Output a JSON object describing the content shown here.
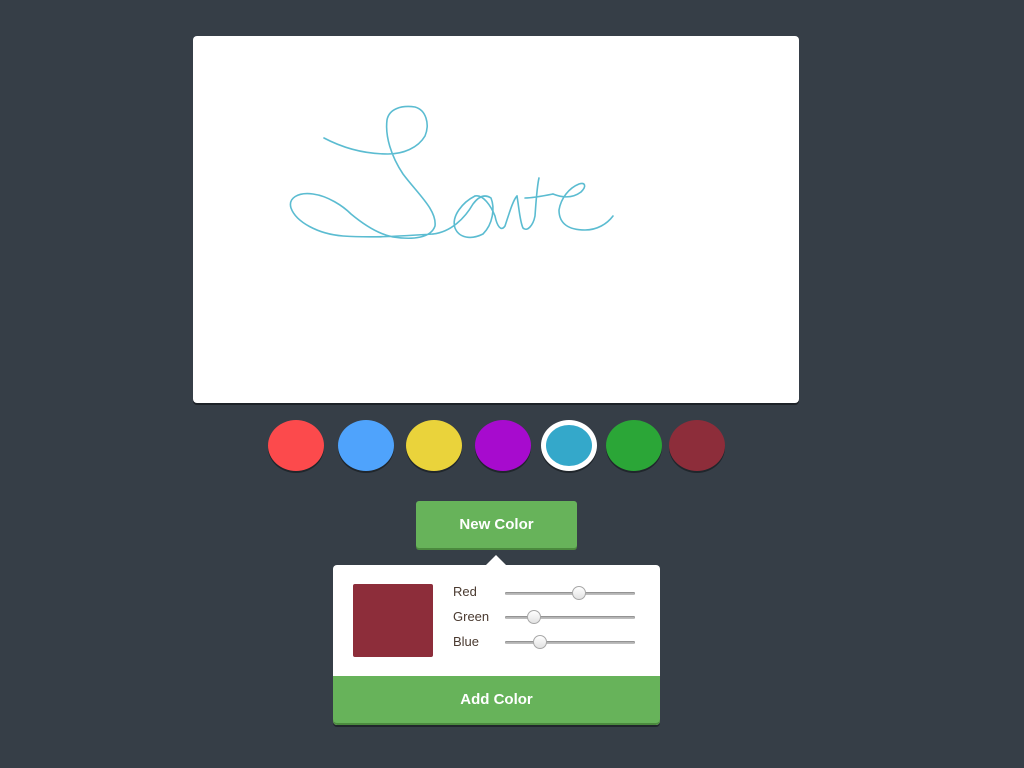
{
  "drawing": {
    "stroke_color": "#5bbcd1"
  },
  "palette": {
    "selected_index": 4,
    "swatches": [
      {
        "color": "#fc4a4c"
      },
      {
        "color": "#4fa3fc"
      },
      {
        "color": "#ead33b"
      },
      {
        "color": "#a70bce"
      },
      {
        "color": "#34a8ca"
      },
      {
        "color": "#2ba637"
      },
      {
        "color": "#8d2d3a"
      }
    ]
  },
  "new_color_button": {
    "label": "New Color",
    "color": "#67b35a"
  },
  "color_picker": {
    "preview_color": "#8d2d3a",
    "sliders": [
      {
        "label": "Red",
        "value_fraction": 0.57
      },
      {
        "label": "Green",
        "value_fraction": 0.22
      },
      {
        "label": "Blue",
        "value_fraction": 0.27
      }
    ],
    "add_button": {
      "label": "Add Color",
      "color": "#67b35a"
    }
  }
}
